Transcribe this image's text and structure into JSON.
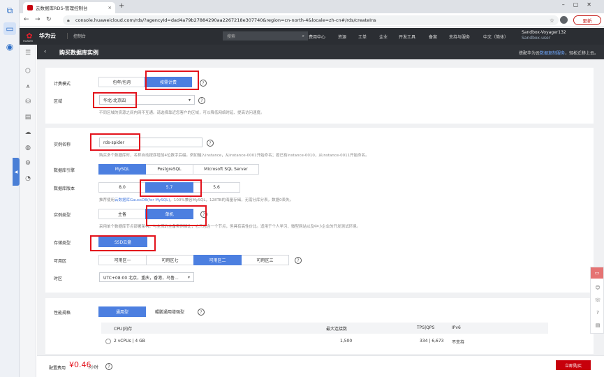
{
  "browser": {
    "tab_title": "云数据库RDS-管理控制台",
    "tab_close": "×",
    "new_tab": "+",
    "url": "console.huaweicloud.com/rds/?agencyId=dad4a79b27884290aa2267218e307740&region=cn-north-4&locale=zh-cn#/rds/createIns",
    "update_label": "更新"
  },
  "topnav": {
    "logo_text": "HUAWEI",
    "brand": "华为云",
    "console": "控制台",
    "search_placeholder": "搜索",
    "menu": [
      "费用中心",
      "资源",
      "工单",
      "企业",
      "开发工具",
      "备案",
      "支持与服务",
      "中文（简体）"
    ],
    "account_name": "Sandbox-Voyager132",
    "account_user": "Sandbox-user"
  },
  "header": {
    "title": "购买数据库实例",
    "note_prefix": "搭配华为云",
    "note_link": "数据复制服务",
    "note_suffix": "，轻松迁移上云。"
  },
  "form": {
    "billing": {
      "label": "计费模式",
      "options": [
        "包年/包月",
        "按需计费"
      ],
      "selected": "按需计费"
    },
    "region": {
      "label": "区域",
      "value": "华北-北京四",
      "hint": "不同区域的资源之间内网不互通。请选择靠近您客户的区域，可以降低网络时延、提高访问速度。"
    },
    "name": {
      "label": "实例名称",
      "value": "rds-spider",
      "hint": "购买多个数据库时，名称自动按序增加4位数字后缀。例如输入instance，从instance-0001开始命名；若已有instance-0010，从instance-0011开始命名。"
    },
    "engine": {
      "label": "数据库引擎",
      "options": [
        "MySQL",
        "PostgreSQL",
        "Microsoft SQL Server"
      ],
      "selected": "MySQL"
    },
    "version": {
      "label": "数据库版本",
      "options": [
        "8.0",
        "5.7",
        "5.6"
      ],
      "selected": "5.7",
      "hint_prefix": "推荐使用",
      "hint_link": "云数据库GaussDB(for MySQL)",
      "hint_suffix": "，100%兼容MySQL，128TB的海量存储，无需分库分表，数据0丢失。"
    },
    "instance_type": {
      "label": "实例类型",
      "options": [
        "主备",
        "单机"
      ],
      "selected": "单机",
      "hint": "采用单个数据库节点部署架构，与主流的主备实例相比，它只包含一个节点，但具有高性价比。适用于个人学习、微型网站以及中小企业的开发测试环境。"
    },
    "storage": {
      "label": "存储类型",
      "value": "SSD云盘"
    },
    "az": {
      "label": "可用区",
      "options": [
        "可用区一",
        "可用区七",
        "可用区二",
        "可用区三"
      ],
      "selected": "可用区二"
    },
    "timezone": {
      "label": "时区",
      "value": "UTC+08:00 北京，重庆，香港，乌鲁..."
    },
    "spec": {
      "label": "性能规格",
      "tabs": [
        "通用型",
        "鲲鹏通用增强型"
      ],
      "selected": "通用型",
      "columns": [
        "CPU|内存",
        "最大连接数",
        "TPS|QPS",
        "IPv6"
      ],
      "rows": [
        {
          "cpu": "2 vCPUs | 4 GB",
          "conn": "1,500",
          "tps": "334 | 6,673",
          "ipv6": "不支持"
        }
      ]
    }
  },
  "footer": {
    "fee_label": "配置费用",
    "fee": "¥0.46",
    "unit": "/小时",
    "buy": "立即购买"
  },
  "accent": "#4c7fe0",
  "brand_red": "#c7000b"
}
